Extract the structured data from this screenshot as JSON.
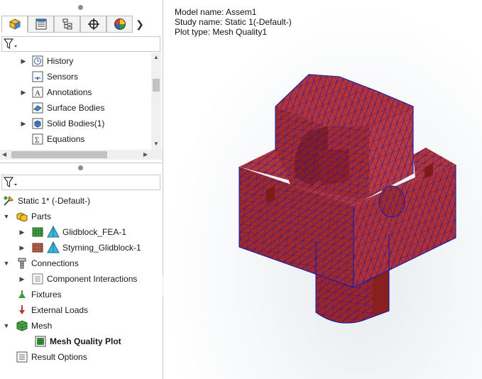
{
  "feature_manager": {
    "tabs": [
      {
        "icon": "part-icon",
        "active": true
      },
      {
        "icon": "property-manager-icon",
        "active": false
      },
      {
        "icon": "configuration-manager-icon",
        "active": false
      },
      {
        "icon": "dimxpert-icon",
        "active": false
      },
      {
        "icon": "display-manager-icon",
        "active": false
      }
    ],
    "items": [
      {
        "label": "History",
        "icon": "history-icon",
        "expandable": true
      },
      {
        "label": "Sensors",
        "icon": "sensors-icon",
        "expandable": false
      },
      {
        "label": "Annotations",
        "icon": "annotations-icon",
        "expandable": true
      },
      {
        "label": "Surface Bodies",
        "icon": "surface-bodies-icon",
        "expandable": false
      },
      {
        "label": "Solid Bodies(1)",
        "icon": "solid-bodies-icon",
        "expandable": true
      },
      {
        "label": "Equations",
        "icon": "equations-icon",
        "expandable": false
      }
    ]
  },
  "simulation_tree": {
    "study": "Static 1* (-Default-)",
    "parts_label": "Parts",
    "parts": [
      "Glidblock_FEA-1",
      "Styrning_Glidblock-1"
    ],
    "connections_label": "Connections",
    "component_interactions": "Component Interactions",
    "fixtures": "Fixtures",
    "external_loads": "External Loads",
    "mesh": "Mesh",
    "mesh_quality_plot": "Mesh Quality Plot",
    "result_options": "Result Options"
  },
  "viewport": {
    "model_name": "Model name: Assem1",
    "study_name": "Study name: Static 1(-Default-)",
    "plot_type": "Plot type: Mesh Quality1",
    "mesh_color": "#a52a2a",
    "mesh_line_color": "#1a1aa8"
  }
}
